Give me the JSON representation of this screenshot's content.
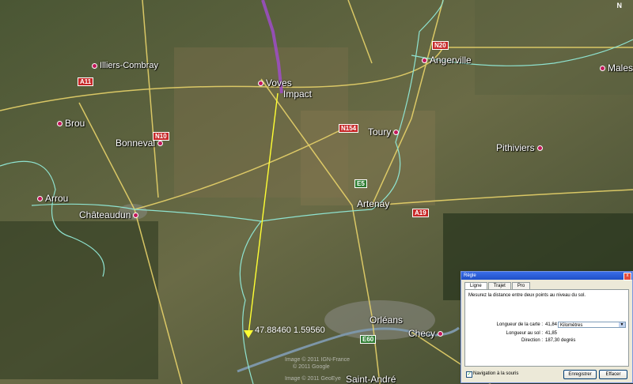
{
  "map": {
    "towns": [
      {
        "id": "illiers",
        "label": "Illiers-Combray"
      },
      {
        "id": "voves",
        "label": "Voves"
      },
      {
        "id": "impact",
        "label": "Impact"
      },
      {
        "id": "angerville",
        "label": "Angerville"
      },
      {
        "id": "malesh",
        "label": "Malesh"
      },
      {
        "id": "brou",
        "label": "Brou"
      },
      {
        "id": "bonneval",
        "label": "Bonneval"
      },
      {
        "id": "toury",
        "label": "Toury"
      },
      {
        "id": "pithiviers",
        "label": "Pithiviers"
      },
      {
        "id": "arrou",
        "label": "Arrou"
      },
      {
        "id": "chateaudun",
        "label": "Châteaudun"
      },
      {
        "id": "artenay",
        "label": "Artenay"
      },
      {
        "id": "orleans",
        "label": "Orléans"
      },
      {
        "id": "checy",
        "label": "Checy"
      },
      {
        "id": "saint-andre",
        "label": "Saint-André"
      }
    ],
    "road_shields": [
      {
        "id": "a11",
        "label": "A11",
        "color": "red"
      },
      {
        "id": "n10",
        "label": "N10",
        "color": "red"
      },
      {
        "id": "n20",
        "label": "N20",
        "color": "red"
      },
      {
        "id": "n154",
        "label": "N154",
        "color": "red"
      },
      {
        "id": "e5",
        "label": "E5",
        "color": "green"
      },
      {
        "id": "a19",
        "label": "A19",
        "color": "red"
      },
      {
        "id": "e60",
        "label": "E60",
        "color": "green"
      }
    ],
    "measure_coordinates": "47.88460 1.59560",
    "copyright_lines": [
      "Image © 2011 IGN-France",
      "© 2011 Google",
      "Image © 2011 GeoEye"
    ],
    "compass_label": "N",
    "colors": {
      "measure_line": "#ffff33",
      "boundary": "#8fe3d0",
      "road": "#e8d36a",
      "track": "#a24bd1"
    }
  },
  "ruler": {
    "title": "Règle",
    "close_label": "x",
    "tabs": [
      "Ligne",
      "Trajet",
      "Pro"
    ],
    "active_tab": "Ligne",
    "description": "Mesurez la distance entre deux points au niveau du sol.",
    "map_length_label": "Longueur de la carte :",
    "map_length_value": "41,84",
    "unit_selected": "Kilomètres",
    "ground_length_label": "Longueur au sol :",
    "ground_length_value": "41,85",
    "direction_label": "Direction :",
    "direction_value": "187,30 degrés",
    "mouse_nav_label": "Navigation à la souris",
    "mouse_nav_checked": true,
    "save_label": "Enregistrer",
    "clear_label": "Effacer"
  }
}
